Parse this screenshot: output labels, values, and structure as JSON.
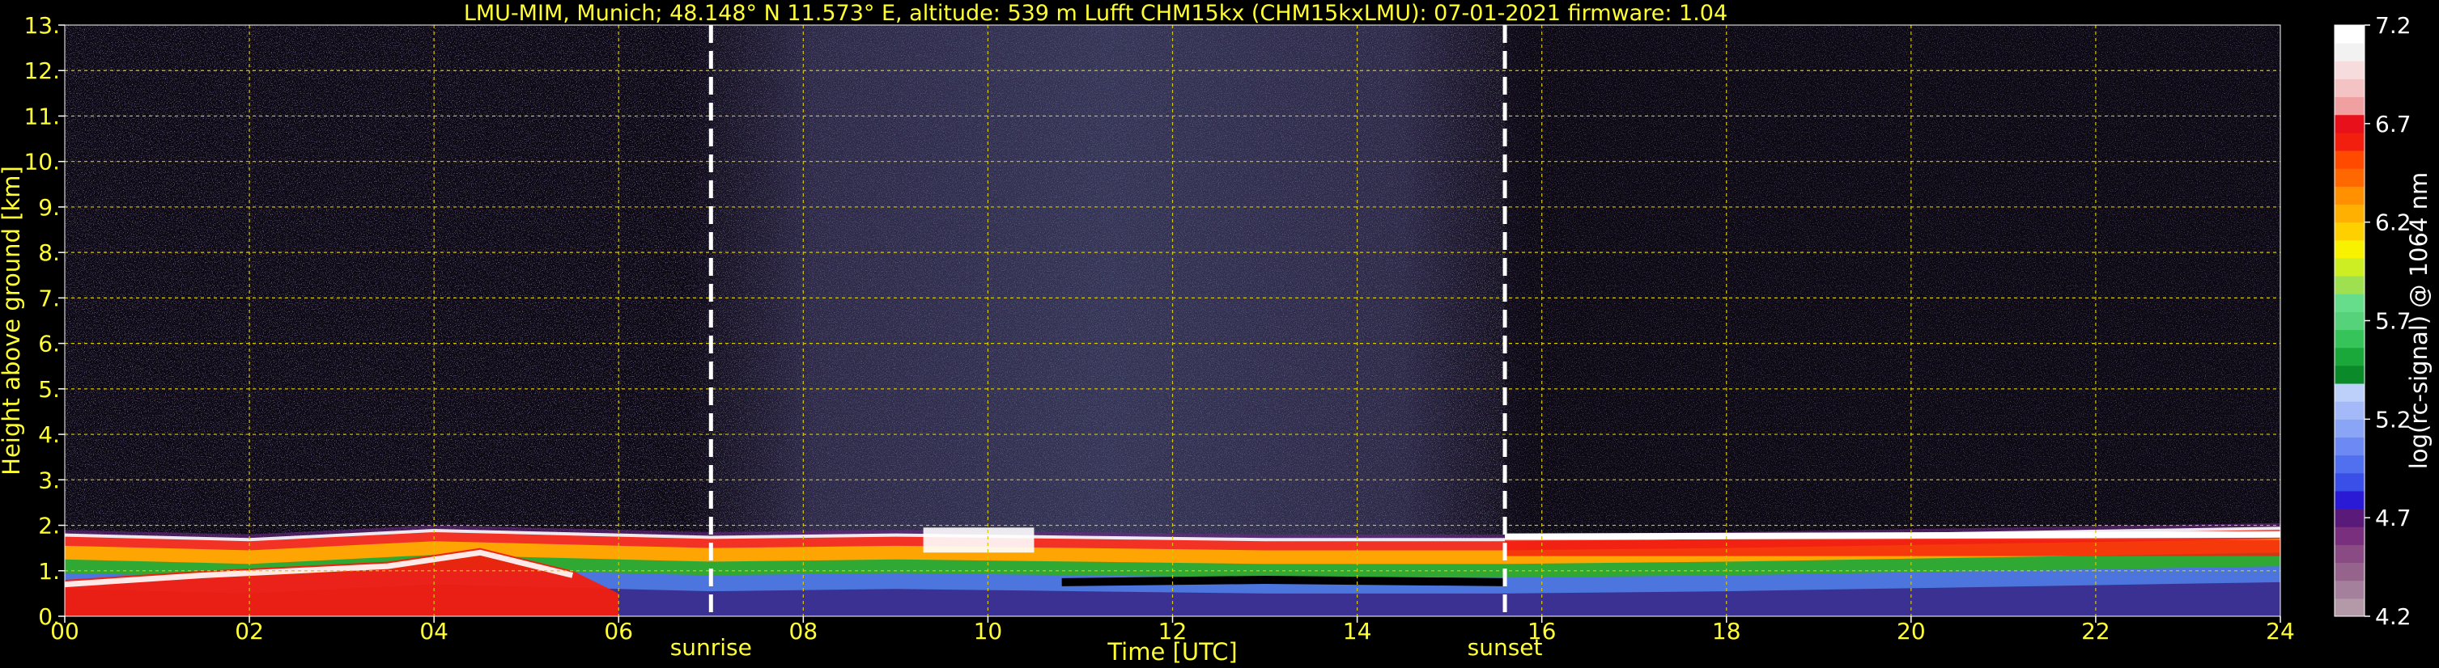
{
  "chart_data": {
    "type": "heatmap",
    "title": "LMU-MIM, Munich; 48.148° N 11.573° E, altitude: 539 m    Lufft CHM15kx (CHM15kxLMU): 07-01-2021    firmware: 1.04",
    "xlabel": "Time [UTC]",
    "ylabel": "Height above ground [km]",
    "x_ticks": [
      "00",
      "02",
      "04",
      "06",
      "08",
      "10",
      "12",
      "14",
      "16",
      "18",
      "20",
      "22",
      "24"
    ],
    "y_ticks": [
      "0.",
      "1.",
      "2.",
      "3.",
      "4.",
      "5.",
      "6.",
      "7.",
      "8.",
      "9.",
      "10.",
      "11.",
      "12.",
      "13."
    ],
    "xlim": [
      0,
      24
    ],
    "ylim": [
      0,
      13
    ],
    "grid": true,
    "events": [
      {
        "label": "sunrise",
        "time": 7.0
      },
      {
        "label": "sunset",
        "time": 15.6
      }
    ],
    "colorbar": {
      "label": "log(rc-signal) @ 1064 nm",
      "ticks": [
        "7.2",
        "6.7",
        "6.2",
        "5.7",
        "5.2",
        "4.7",
        "4.2"
      ],
      "range": [
        4.2,
        7.2
      ],
      "colors": [
        "#b49aa9",
        "#a5809c",
        "#95638c",
        "#8a4a84",
        "#7a2e7e",
        "#5a1a7a",
        "#2a1ad6",
        "#3a4ee8",
        "#5070f0",
        "#6d8af4",
        "#8aa4f6",
        "#a4baf8",
        "#bcd0fa",
        "#0b8a2a",
        "#1aa83a",
        "#36c45a",
        "#55d27a",
        "#66dd8a",
        "#9ee050",
        "#ccee22",
        "#f8f200",
        "#ffd000",
        "#ffb000",
        "#ff9000",
        "#ff6800",
        "#ff4a00",
        "#f21e0e",
        "#e8101a",
        "#f0a0a0",
        "#f4c4c4",
        "#f6dcdc",
        "#f2f2f2",
        "#ffffff"
      ]
    },
    "profile_overview": {
      "cloud_top_km": [
        {
          "time": 0.0,
          "value": 1.9
        },
        {
          "time": 2.0,
          "value": 1.8
        },
        {
          "time": 4.0,
          "value": 2.0
        },
        {
          "time": 6.0,
          "value": 1.9
        },
        {
          "time": 7.0,
          "value": 1.85
        },
        {
          "time": 9.0,
          "value": 1.9
        },
        {
          "time": 11.0,
          "value": 1.85
        },
        {
          "time": 13.0,
          "value": 1.8
        },
        {
          "time": 15.6,
          "value": 1.8
        },
        {
          "time": 18.0,
          "value": 1.85
        },
        {
          "time": 21.0,
          "value": 1.95
        },
        {
          "time": 24.0,
          "value": 2.05
        }
      ]
    }
  }
}
